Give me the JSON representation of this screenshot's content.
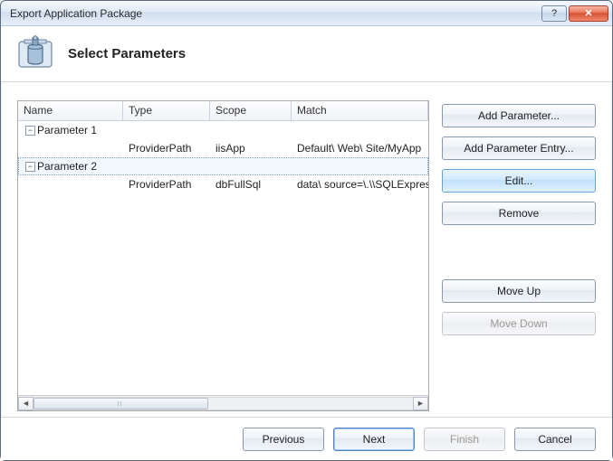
{
  "window": {
    "title": "Export Application Package"
  },
  "header": {
    "heading": "Select Parameters"
  },
  "grid": {
    "columns": {
      "name": "Name",
      "type": "Type",
      "scope": "Scope",
      "match": "Match"
    },
    "rows": [
      {
        "kind": "group",
        "expanded": true,
        "selected": false,
        "name": "Parameter 1"
      },
      {
        "kind": "data",
        "name": "",
        "type": "ProviderPath",
        "scope": "iisApp",
        "match": "Default\\ Web\\ Site/MyApp"
      },
      {
        "kind": "group",
        "expanded": true,
        "selected": true,
        "name": "Parameter 2"
      },
      {
        "kind": "data",
        "name": "",
        "type": "ProviderPath",
        "scope": "dbFullSql",
        "match": "data\\ source=\\.\\\\SQLExpress"
      }
    ]
  },
  "sideButtons": {
    "addParameter": "Add Parameter...",
    "addParameterEntry": "Add Parameter Entry...",
    "edit": "Edit...",
    "remove": "Remove",
    "moveUp": "Move Up",
    "moveDown": "Move Down"
  },
  "footer": {
    "previous": "Previous",
    "next": "Next",
    "finish": "Finish",
    "cancel": "Cancel"
  }
}
